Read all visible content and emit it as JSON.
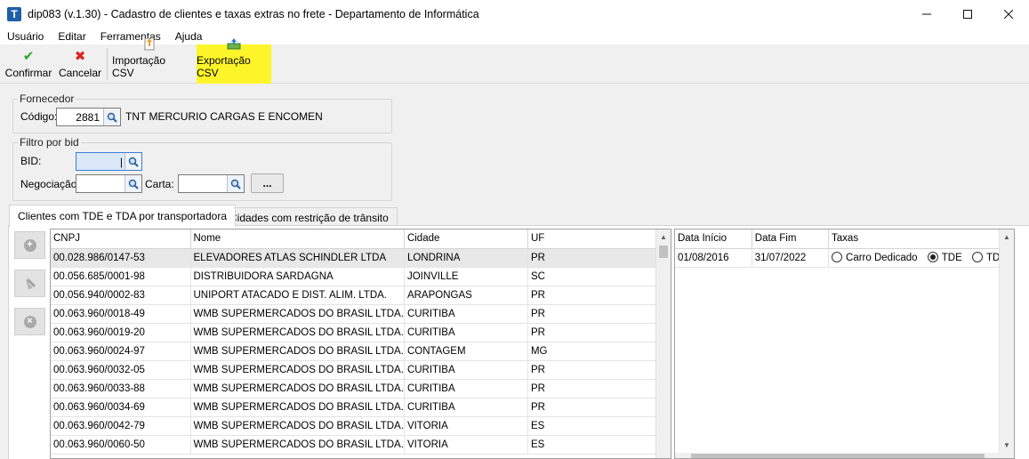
{
  "window": {
    "icon_letter": "T",
    "title": "dip083 (v.1.30) - Cadastro de clientes e taxas extras no frete - Departamento de Informática"
  },
  "menu": [
    "Usuário",
    "Editar",
    "Ferramentas",
    "Ajuda"
  ],
  "toolbar": {
    "confirm": "Confirmar",
    "cancel": "Cancelar",
    "import_csv": "Importação CSV",
    "export_csv": "Exportação CSV",
    "highlight_color": "#fdf52a"
  },
  "fornecedor": {
    "title": "Fornecedor",
    "codigo_label": "Código:",
    "codigo_value": "2881",
    "name": "TNT MERCURIO CARGAS E ENCOMEN"
  },
  "filtro": {
    "title": "Filtro por bid",
    "bid_label": "BID:",
    "negociacao_label": "Negociação:",
    "carta_label": "Carta:",
    "dots_label": "..."
  },
  "tabs": [
    {
      "label": "Clientes com TDE e TDA por transportadora",
      "active": true
    },
    {
      "label": "Cidades com restrição de trânsito",
      "active": false
    }
  ],
  "clients": {
    "columns": [
      "CNPJ",
      "Nome",
      "Cidade",
      "UF"
    ],
    "rows": [
      [
        "00.028.986/0147-53",
        "ELEVADORES ATLAS SCHINDLER LTDA",
        "LONDRINA",
        "PR"
      ],
      [
        "00.056.685/0001-98",
        "DISTRIBUIDORA SARDAGNA",
        "JOINVILLE",
        "SC"
      ],
      [
        "00.056.940/0002-83",
        "UNIPORT ATACADO E DIST. ALIM. LTDA.",
        "ARAPONGAS",
        "PR"
      ],
      [
        "00.063.960/0018-49",
        "WMB SUPERMERCADOS DO BRASIL LTDA.",
        "CURITIBA",
        "PR"
      ],
      [
        "00.063.960/0019-20",
        "WMB SUPERMERCADOS DO BRASIL LTDA.",
        "CURITIBA",
        "PR"
      ],
      [
        "00.063.960/0024-97",
        "WMB SUPERMERCADOS DO BRASIL LTDA.",
        "CONTAGEM",
        "MG"
      ],
      [
        "00.063.960/0032-05",
        "WMB SUPERMERCADOS DO BRASIL LTDA.",
        "CURITIBA",
        "PR"
      ],
      [
        "00.063.960/0033-88",
        "WMB SUPERMERCADOS DO BRASIL LTDA.",
        "CURITIBA",
        "PR"
      ],
      [
        "00.063.960/0034-69",
        "WMB SUPERMERCADOS DO BRASIL LTDA.",
        "CURITIBA",
        "PR"
      ],
      [
        "00.063.960/0042-79",
        "WMB SUPERMERCADOS DO BRASIL LTDA.",
        "VITORIA",
        "ES"
      ],
      [
        "00.063.960/0060-50",
        "WMB SUPERMERCADOS DO BRASIL LTDA.",
        "VITORIA",
        "ES"
      ]
    ]
  },
  "taxes": {
    "columns": [
      "Data Início",
      "Data Fim",
      "Taxas"
    ],
    "row": {
      "start": "01/08/2016",
      "end": "31/07/2022",
      "options": [
        {
          "label": "Carro Dedicado",
          "checked": false
        },
        {
          "label": "TDE",
          "checked": true
        },
        {
          "label": "TDE",
          "checked": false
        }
      ]
    }
  }
}
